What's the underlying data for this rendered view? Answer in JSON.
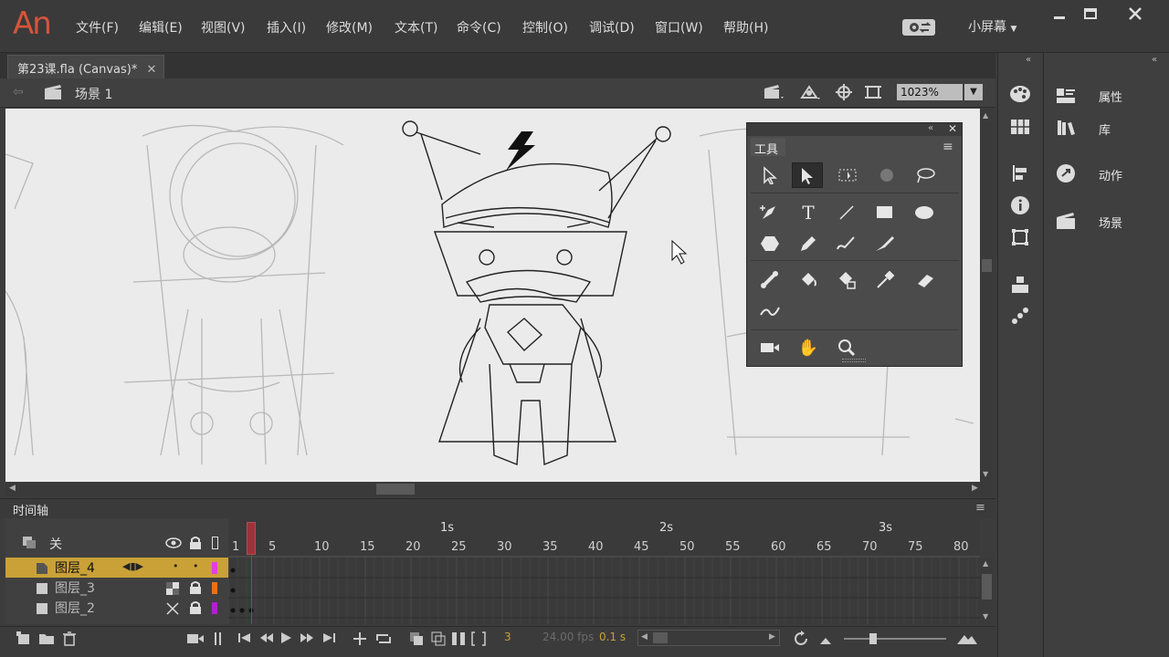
{
  "app": {
    "logo": "An"
  },
  "menu": [
    "文件(F)",
    "编辑(E)",
    "视图(V)",
    "插入(I)",
    "修改(M)",
    "文本(T)",
    "命令(C)",
    "控制(O)",
    "调试(D)",
    "窗口(W)",
    "帮助(H)"
  ],
  "workspace": {
    "label": "小屏幕"
  },
  "document": {
    "tab": "第23课.fla (Canvas)*"
  },
  "scene": {
    "name": "场景 1",
    "zoom": "1023%"
  },
  "tools_panel": {
    "title": "工具"
  },
  "right_panels": {
    "properties": "属性",
    "library": "库",
    "actions": "动作",
    "scene": "场景"
  },
  "timeline": {
    "title": "时间轴",
    "outline_label": "关",
    "time_markers": [
      "1s",
      "2s",
      "3s"
    ],
    "frame_numbers": [
      "1",
      "5",
      "10",
      "15",
      "20",
      "25",
      "30",
      "35",
      "40",
      "45",
      "50",
      "55",
      "60",
      "65",
      "70",
      "75",
      "80"
    ],
    "layers": [
      {
        "name": "图层_4",
        "selected": true,
        "color": "#e040e0"
      },
      {
        "name": "图层_3",
        "selected": false,
        "color": "#f07010"
      },
      {
        "name": "图层_2",
        "selected": false,
        "color": "#b020d0"
      }
    ],
    "current_frame": "3",
    "fps": "24.00 fps",
    "elapsed": "0.1 s"
  },
  "colors": {
    "selected_layer": "#d4a531",
    "playhead": "#c0303a",
    "logo": "#d4553a"
  }
}
